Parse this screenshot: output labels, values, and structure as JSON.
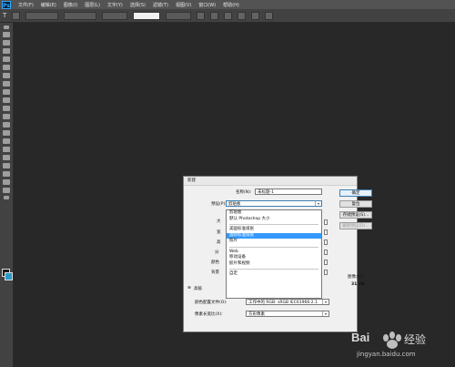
{
  "app": {
    "logo": "Ps"
  },
  "menu": [
    "文件(F)",
    "编辑(E)",
    "图像(I)",
    "图层(L)",
    "文字(Y)",
    "选择(S)",
    "滤镜(T)",
    "视图(V)",
    "窗口(W)",
    "帮助(H)"
  ],
  "options_bar": {
    "tool_glyph": "T",
    "font_family": "",
    "font_style": "",
    "font_size": "",
    "anti_alias": ""
  },
  "dialog": {
    "title": "新建",
    "name_label": "名称(N):",
    "name_value": "未标题-1",
    "preset_label": "预设(P):",
    "preset_value": "剪贴板",
    "partial_labels": [
      "大",
      "宽",
      "高",
      "分",
      "颜色",
      "背景"
    ],
    "advanced_label": "高级",
    "color_profile_label": "颜色配置文件(O):",
    "color_profile_value": "工作中的 RGB: sRGB IEC61966-2.1",
    "pixel_aspect_label": "像素长宽比(X):",
    "pixel_aspect_value": "方形像素",
    "image_size_label": "图像大小:",
    "image_size_value": "31.1K",
    "buttons": {
      "ok": "确定",
      "reset": "复位",
      "save_preset": "存储预设(S)...",
      "delete_preset": "删除预设(D)..."
    },
    "preset_options": [
      "剪贴板",
      "默认 Photoshop 大小",
      "美国标准纸张",
      "国际标准纸张",
      "照片",
      "Web",
      "移动设备",
      "胶片和视频",
      "自定"
    ],
    "preset_selected_index": 3
  },
  "watermark": {
    "brand": "Bai",
    "brand2": "经验",
    "url": "jingyan.baidu.com"
  }
}
